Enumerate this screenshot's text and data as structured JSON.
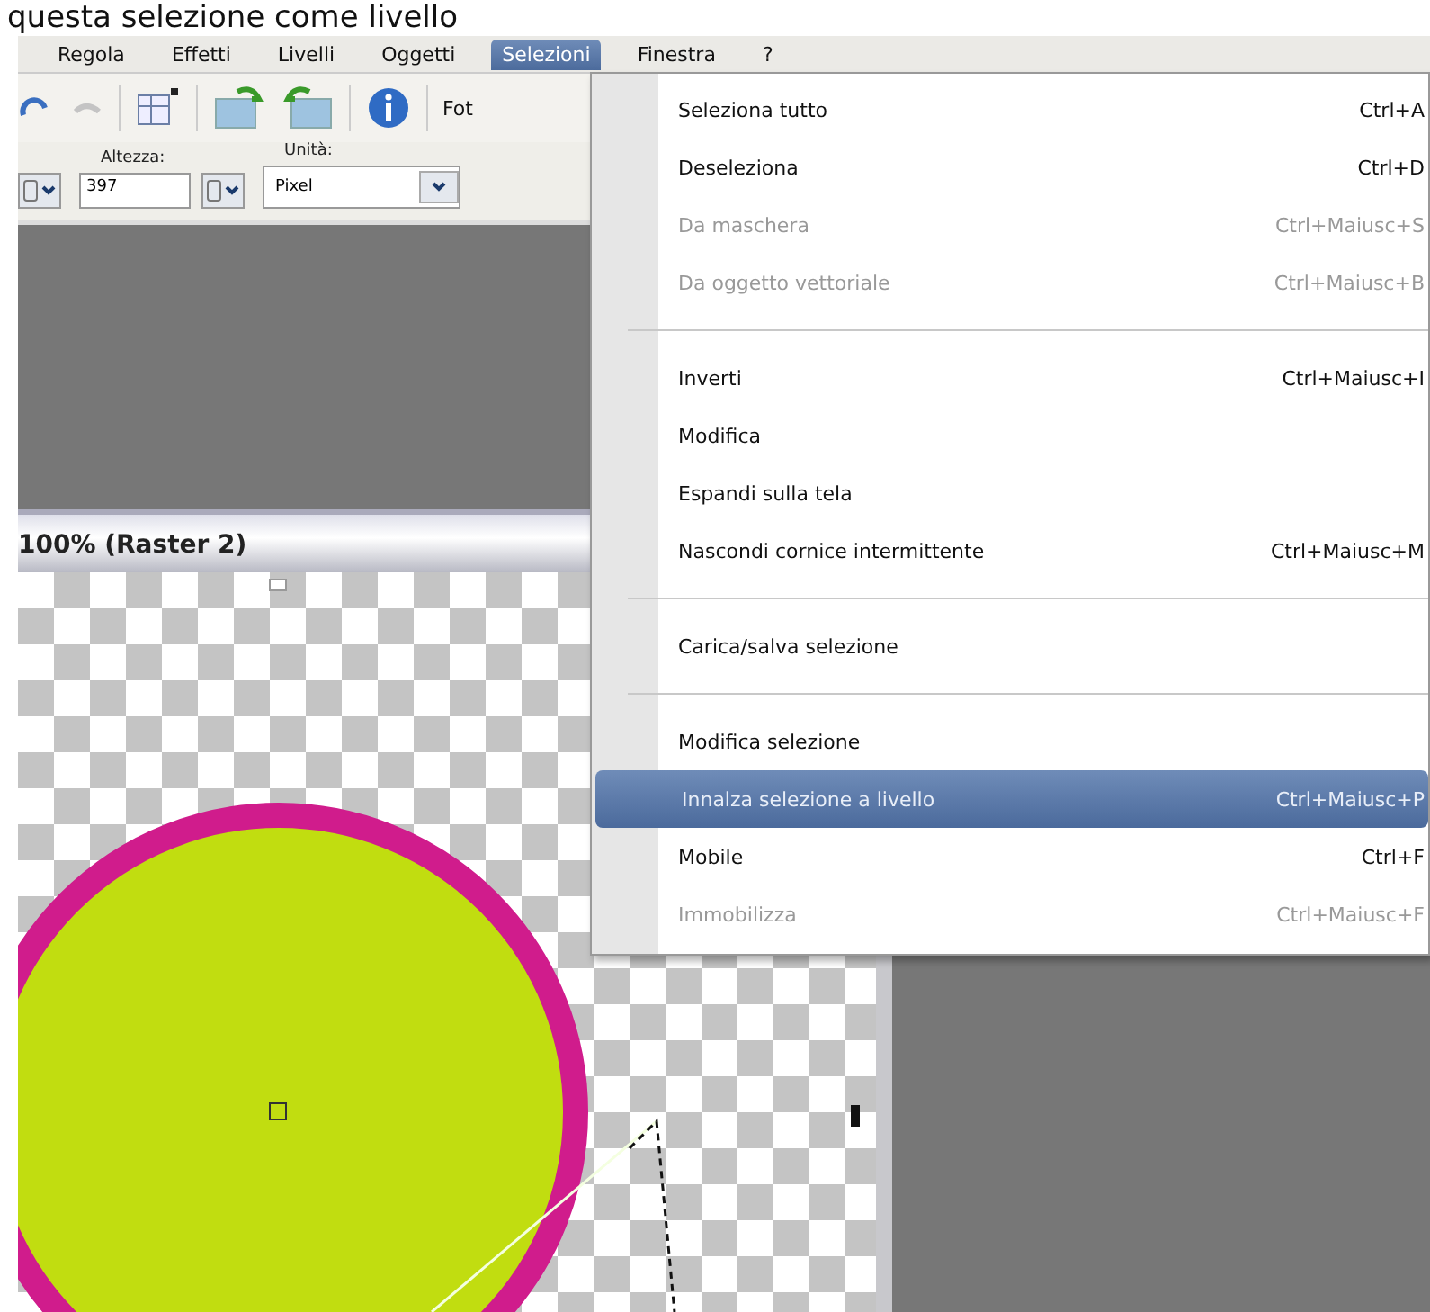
{
  "heading": "questa selezione come livello",
  "menubar": [
    {
      "label": "Regola",
      "selected": false
    },
    {
      "label": "Effetti",
      "selected": false
    },
    {
      "label": "Livelli",
      "selected": false
    },
    {
      "label": "Oggetti",
      "selected": false
    },
    {
      "label": "Selezioni",
      "selected": true
    },
    {
      "label": "Finestra",
      "selected": false
    },
    {
      "label": "?",
      "selected": false
    }
  ],
  "toolbar": {
    "label": "Fot"
  },
  "options": {
    "height_label": "Altezza:",
    "height_value": "397",
    "unit_label": "Unità:",
    "unit_value": "Pixel"
  },
  "document": {
    "title": "100% (Raster 2)"
  },
  "menu": {
    "items": [
      {
        "kind": "item",
        "label": "Seleziona tutto",
        "shortcut": "Ctrl+A",
        "disabled": false,
        "selected": false
      },
      {
        "kind": "item",
        "label": "Deseleziona",
        "shortcut": "Ctrl+D",
        "disabled": false,
        "selected": false
      },
      {
        "kind": "item",
        "label": "Da maschera",
        "shortcut": "Ctrl+Maiusc+S",
        "disabled": true,
        "selected": false
      },
      {
        "kind": "item",
        "label": "Da oggetto vettoriale",
        "shortcut": "Ctrl+Maiusc+B",
        "disabled": true,
        "selected": false
      },
      {
        "kind": "separator"
      },
      {
        "kind": "item",
        "label": "Inverti",
        "shortcut": "Ctrl+Maiusc+I",
        "disabled": false,
        "selected": false
      },
      {
        "kind": "item",
        "label": "Modifica",
        "disabled": false,
        "selected": false
      },
      {
        "kind": "item",
        "label": "Espandi sulla tela",
        "disabled": false,
        "selected": false
      },
      {
        "kind": "item",
        "label": "Nascondi cornice intermittente",
        "shortcut": "Ctrl+Maiusc+M",
        "disabled": false,
        "selected": false
      },
      {
        "kind": "separator"
      },
      {
        "kind": "item",
        "label": "Carica/salva selezione",
        "disabled": false,
        "selected": false
      },
      {
        "kind": "separator"
      },
      {
        "kind": "item",
        "label": "Modifica selezione",
        "disabled": false,
        "selected": false
      },
      {
        "kind": "item",
        "label": "Innalza selezione a livello",
        "shortcut": "Ctrl+Maiusc+P",
        "disabled": false,
        "selected": true
      },
      {
        "kind": "item",
        "label": "Mobile",
        "shortcut": "Ctrl+F",
        "disabled": false,
        "selected": false
      },
      {
        "kind": "item",
        "label": "Immobilizza",
        "shortcut": "Ctrl+Maiusc+F",
        "disabled": true,
        "selected": false
      }
    ]
  }
}
